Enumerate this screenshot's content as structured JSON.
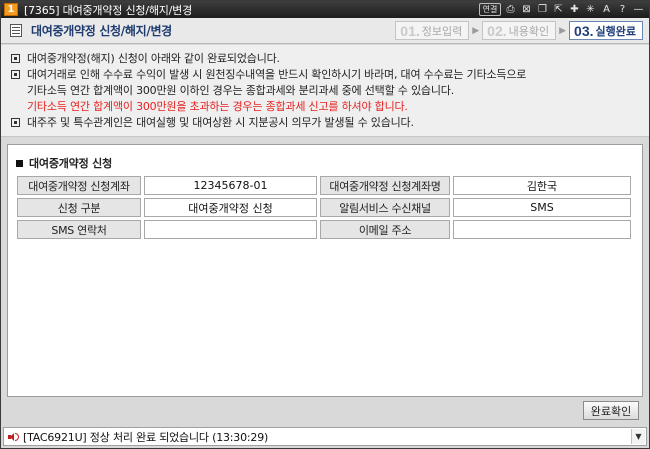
{
  "window": {
    "number": "1",
    "title": "[7365] 대여중개약정 신청/해지/변경"
  },
  "titlebar_icons": [
    {
      "name": "link-icon",
      "glyph": "연결"
    },
    {
      "name": "print-icon",
      "glyph": "⎙"
    },
    {
      "name": "close-box-icon",
      "glyph": "⊠"
    },
    {
      "name": "copy-icon",
      "glyph": "❐"
    },
    {
      "name": "popout-icon",
      "glyph": "⇱"
    },
    {
      "name": "pin-icon",
      "glyph": "✚"
    },
    {
      "name": "settings-icon",
      "glyph": "✳"
    },
    {
      "name": "font-icon",
      "glyph": "A"
    },
    {
      "name": "help-icon",
      "glyph": "?"
    },
    {
      "name": "minimize-icon",
      "glyph": "—"
    }
  ],
  "header": {
    "title": "대여중개약정 신청/해지/변경",
    "steps": [
      {
        "num": "01.",
        "label": "정보입력"
      },
      {
        "num": "02.",
        "label": "내용확인"
      },
      {
        "num": "03.",
        "label": "실행완료"
      }
    ],
    "step_arrow": "▶",
    "active_step": 2
  },
  "notices": [
    {
      "text": "대여중개약정(해지) 신청이 아래와 같이 완료되었습니다.",
      "bullet": true,
      "red": false
    },
    {
      "text": "대여거래로 인해 수수료 수익이 발생 시 원천징수내역을 반드시 확인하시기 바라며, 대여 수수료는 기타소득으로",
      "bullet": true,
      "red": false
    },
    {
      "text": "기타소득 연간 합계액이 300만원 이하인 경우는 종합과세와 분리과세 중에 선택할 수 있습니다.",
      "bullet": false,
      "red": false
    },
    {
      "text": "기타소득 연간 합계액이 300만원을 초과하는 경우는 종합과세 신고를 하셔야 합니다.",
      "bullet": false,
      "red": true
    },
    {
      "text": "대주주 및 특수관계인은 대여실행 및 대여상환 시 지분공시 의무가 발생될 수 있습니다.",
      "bullet": true,
      "red": false
    }
  ],
  "section": {
    "title": "대여중개약정 신청"
  },
  "table": {
    "rows": [
      {
        "label1": "대여중개약정 신청계좌",
        "value1": "12345678-01",
        "label2": "대여중개약정 신청계좌명",
        "value2": "김한국"
      },
      {
        "label1": "신청 구분",
        "value1": "대여중개약정 신청",
        "label2": "알림서비스 수신채널",
        "value2": "SMS"
      },
      {
        "label1": "SMS 연락처",
        "value1": "",
        "label2": "이메일 주소",
        "value2": ""
      }
    ]
  },
  "buttons": {
    "confirm": "완료확인"
  },
  "statusbar": {
    "message": "[TAC6921U] 정상 처리 완료 되었습니다 (13:30:29)",
    "dropdown_glyph": "▼"
  },
  "colors": {
    "title_accent": "#1d3b6e",
    "warning_red": "#e52222",
    "window_number": "#f39b1f"
  }
}
